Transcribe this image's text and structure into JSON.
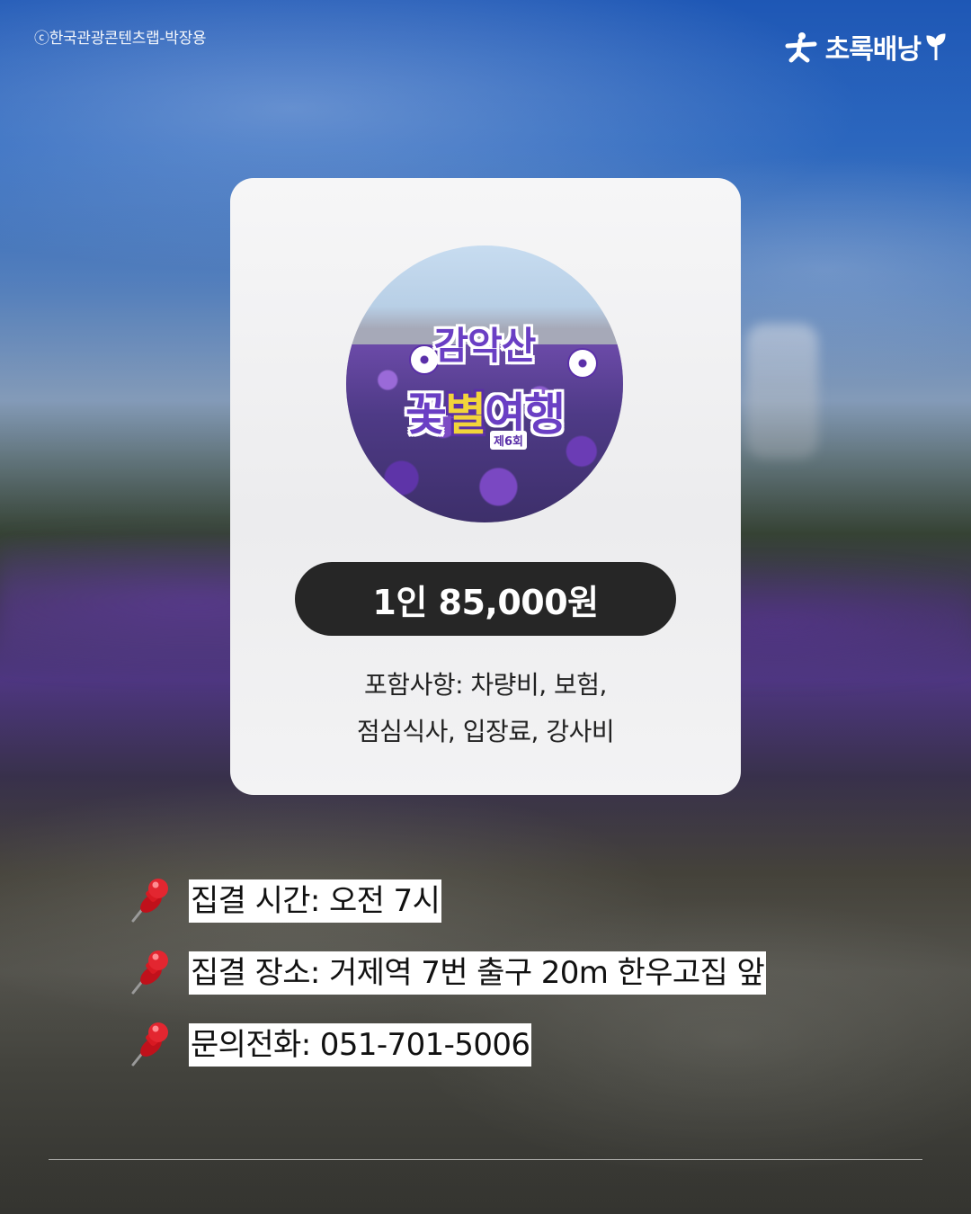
{
  "credit": "ⓒ한국관광콘텐츠랩-박장용",
  "logo": {
    "text": "초록배낭",
    "icon": "running-person-sprout-icon"
  },
  "card": {
    "poster": {
      "title_line1": "감악산",
      "title_line2_a": "꽃",
      "title_line2_b": "별",
      "title_line2_c": "여행",
      "edition": "제6회"
    },
    "price": "1인 85,000원",
    "includes_line1": "포함사항: 차량비, 보험,",
    "includes_line2": "점심식사, 입장료, 강사비"
  },
  "info": [
    {
      "icon": "pushpin-icon",
      "text": "집결 시간: 오전 7시"
    },
    {
      "icon": "pushpin-icon",
      "text": "집결 장소: 거제역 7번 출구 20m 한우고집 앞"
    },
    {
      "icon": "pushpin-icon",
      "text": "문의전화: 051-701-5006"
    }
  ],
  "colors": {
    "pill": "#262626",
    "card": "#f2f2f3",
    "accent_purple": "#6a3fc4",
    "accent_yellow": "#f2d43a"
  }
}
